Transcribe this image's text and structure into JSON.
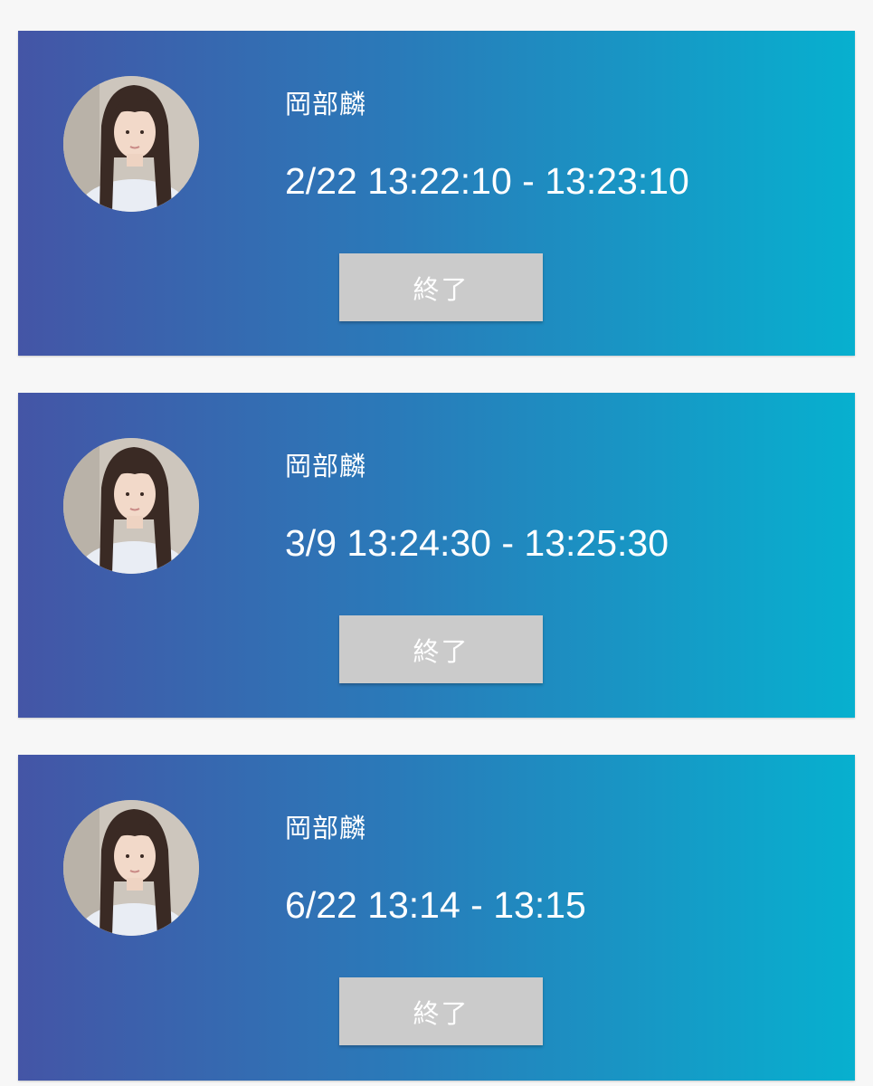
{
  "sessions": [
    {
      "name": "岡部麟",
      "time_range": "2/22 13:22:10 - 13:23:10",
      "button_label": "終了"
    },
    {
      "name": "岡部麟",
      "time_range": "3/9 13:24:30 - 13:25:30",
      "button_label": "終了"
    },
    {
      "name": "岡部麟",
      "time_range": "6/22 13:14 - 13:15",
      "button_label": "終了"
    }
  ],
  "colors": {
    "card_gradient_start": "#4455a6",
    "card_gradient_end": "#07b0cf",
    "button_bg": "#cbcbcb",
    "page_bg": "#f7f7f7"
  }
}
